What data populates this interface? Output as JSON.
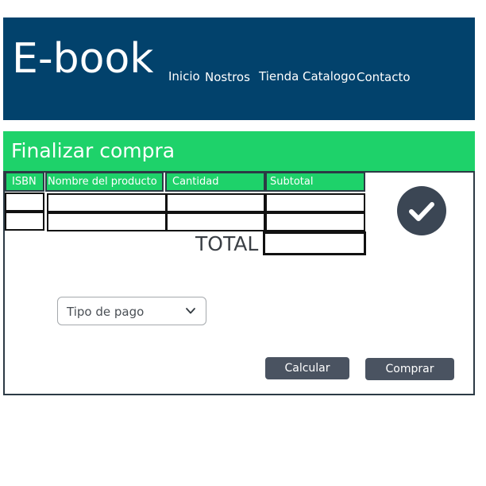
{
  "header": {
    "brand": "E-book",
    "nav": [
      "Inicio",
      "Nostros",
      "Tienda",
      "Catalogo",
      "Contacto"
    ],
    "background": "#02426c"
  },
  "section": {
    "title": "Finalizar compra",
    "accent": "#1ed26a"
  },
  "table": {
    "columns": [
      "ISBN",
      "Nombre del producto",
      "Cantidad",
      "Subtotal"
    ],
    "rows": [
      [
        "",
        "",
        "",
        ""
      ],
      [
        "",
        "",
        "",
        ""
      ]
    ],
    "total_label": "TOTAL",
    "total_value": ""
  },
  "confirm_icon": "checkmark-circle-icon",
  "payment": {
    "selected": "Tipo de pago",
    "icon": "chevron-down-icon"
  },
  "buttons": {
    "calcular": "Calcular",
    "comprar": "Comprar",
    "color": "#4a5361"
  }
}
